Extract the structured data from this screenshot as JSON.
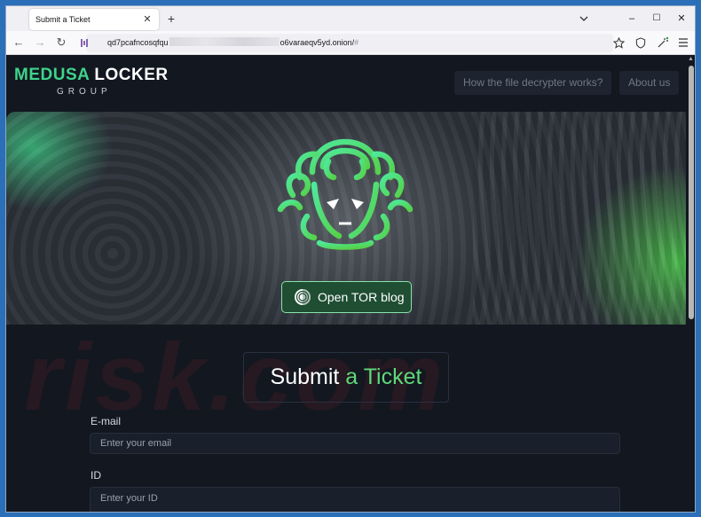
{
  "browser": {
    "tab_title": "Submit a Ticket",
    "tab_close": "✕",
    "new_tab": "+",
    "window_controls": {
      "minimize": "–",
      "maximize": "☐",
      "close": "✕"
    },
    "nav": {
      "back": "←",
      "forward": "→",
      "reload": "↻"
    },
    "url_prefix": "qd7pcafncosqfqu",
    "url_suffix": "o6varaeqv5yd.onion/",
    "url_hash": "#"
  },
  "site": {
    "logo_word1": "MEDUSA",
    "logo_word2": "LOCKER",
    "logo_sub": "GROUP",
    "nav_links": [
      "How the file decrypter works?",
      "About us"
    ],
    "tor_button": "Open TOR blog",
    "submit_word1": "Submit",
    "submit_word2": "a Ticket",
    "watermark": "risk.com",
    "form": {
      "email_label": "E-mail",
      "email_placeholder": "Enter your email",
      "id_label": "ID",
      "id_placeholder": "Enter your ID"
    }
  },
  "colors": {
    "brand_green": "#3fd48a",
    "accent_green": "#5ed97a",
    "page_bg": "#121720",
    "desktop_bg": "#2a6fb8"
  },
  "icons": [
    "close-icon",
    "plus-icon",
    "minimize-icon",
    "maximize-icon",
    "back-arrow-icon",
    "forward-arrow-icon",
    "reload-icon",
    "tor-onion-icon",
    "bookmark-star-icon",
    "shield-icon",
    "extensions-icon",
    "menu-icon",
    "medusa-logo-icon"
  ]
}
